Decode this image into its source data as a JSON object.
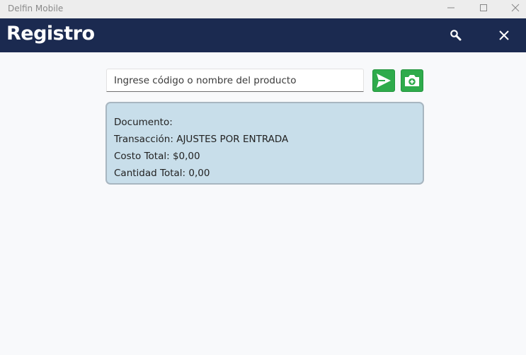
{
  "window": {
    "title": "Delfin Mobile"
  },
  "appbar": {
    "title": "Registro",
    "search_icon": "search-icon",
    "close_icon": "close-icon",
    "background": "#1b2a50"
  },
  "search": {
    "placeholder": "Ingrese código o nombre del producto",
    "value": ""
  },
  "actions": {
    "send_icon": "send-icon",
    "camera_icon": "camera-plus-icon",
    "color": "#2eab4b"
  },
  "info": {
    "documento_label": "Documento:",
    "documento_value": "",
    "transaccion_label": "Transacción:",
    "transaccion_value": "AJUSTES POR ENTRADA",
    "costo_label": "Costo Total:",
    "costo_value": "$0,00",
    "cantidad_label": "Cantidad Total:",
    "cantidad_value": "0,00",
    "background": "#c8deea"
  }
}
